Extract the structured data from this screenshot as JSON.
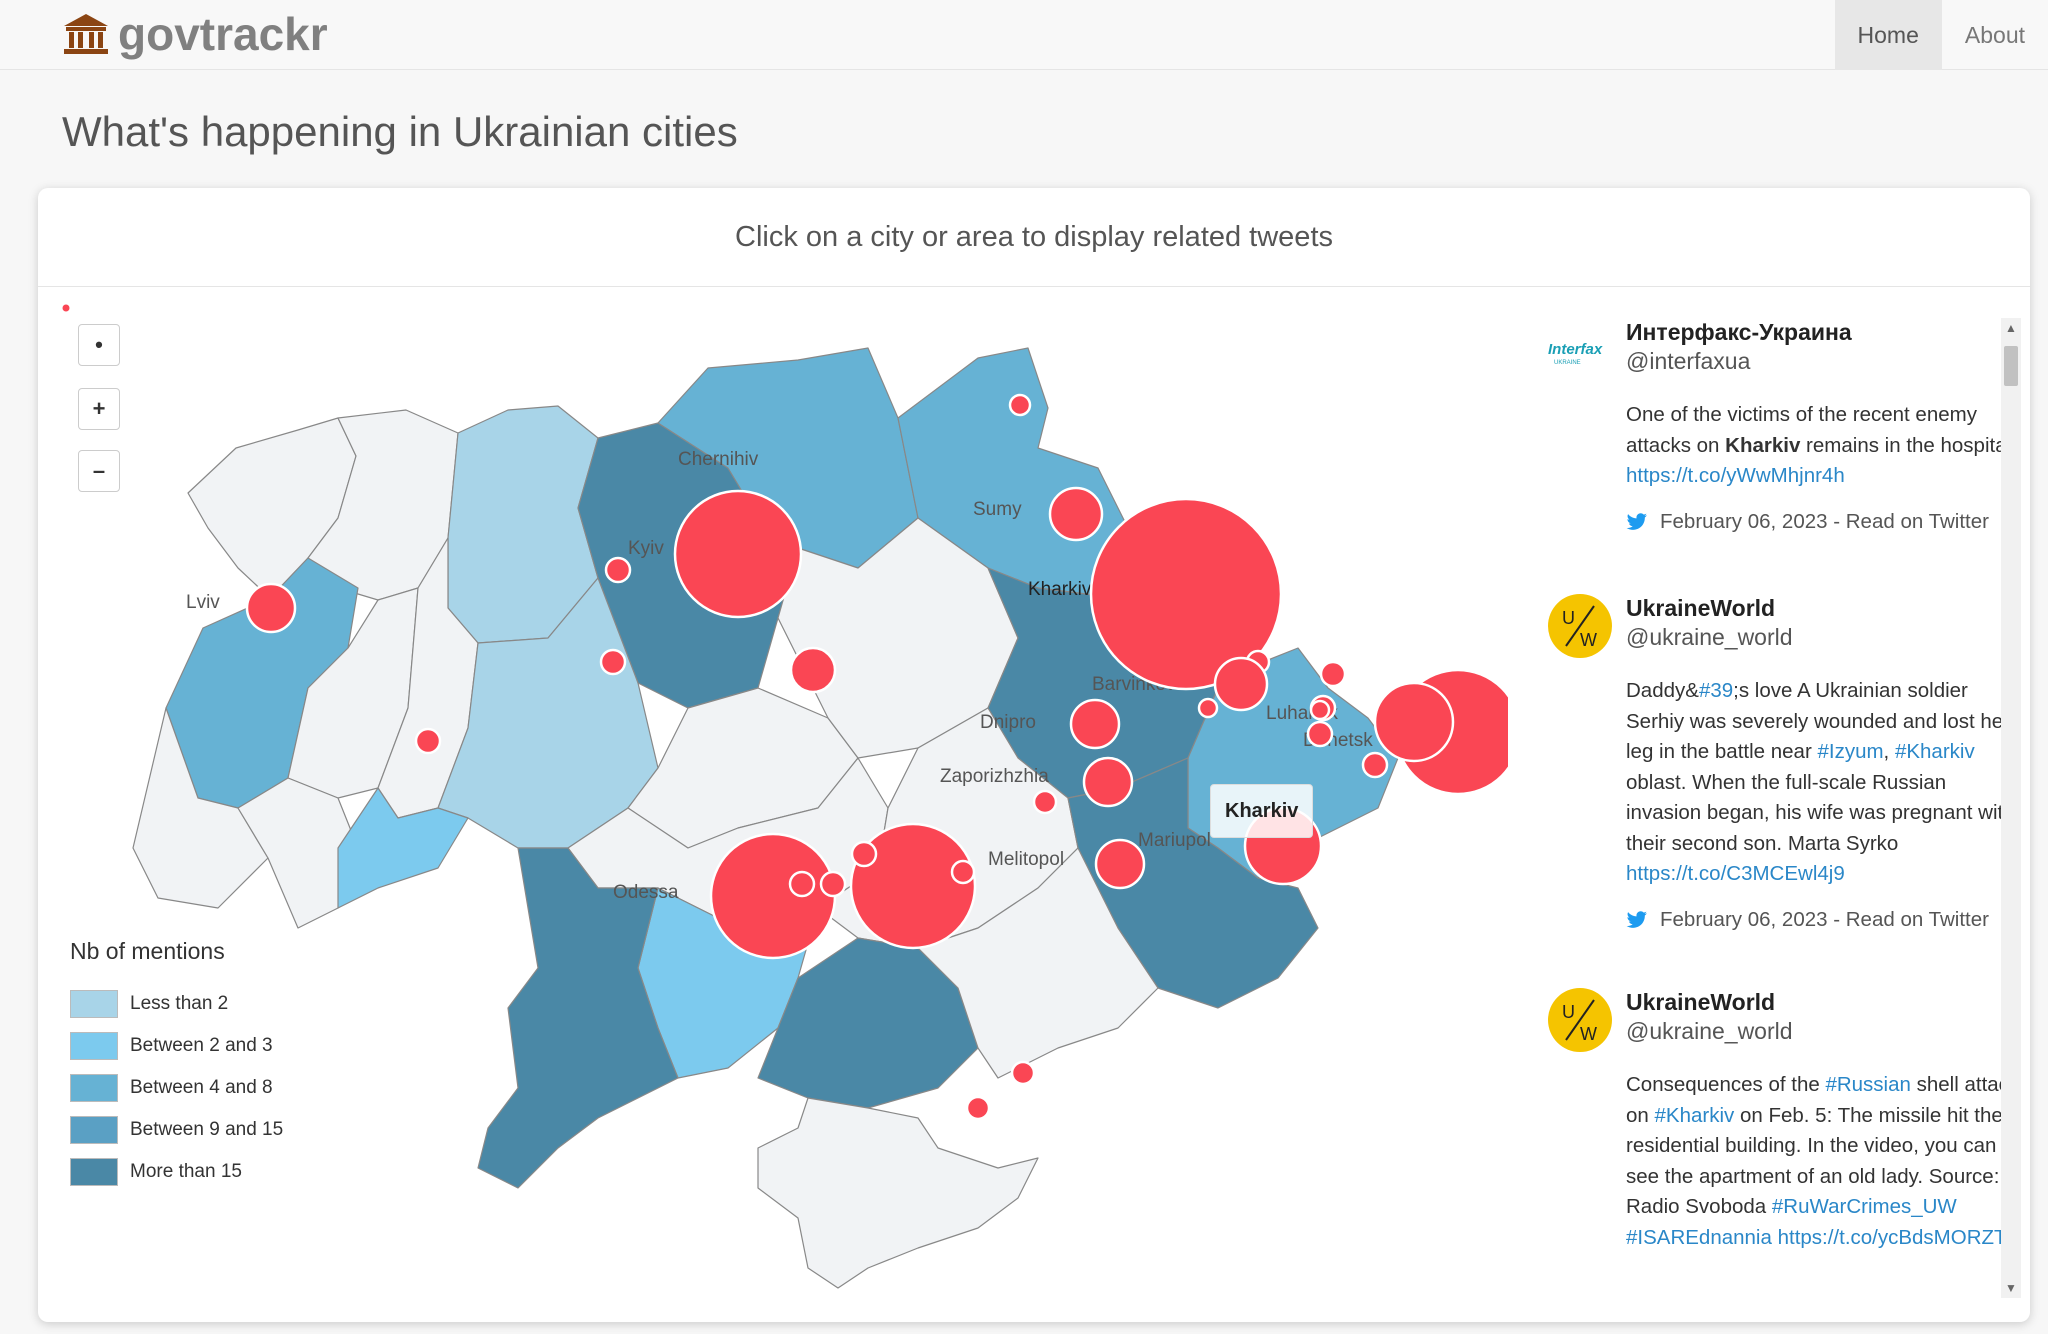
{
  "brand": {
    "name": "govtrackr"
  },
  "nav": {
    "items": [
      {
        "label": "Home"
      },
      {
        "label": "About"
      }
    ]
  },
  "page": {
    "title": "What's happening in Ukrainian cities"
  },
  "panel": {
    "header": "Click on a city or area to display related tweets"
  },
  "map": {
    "zoom": {
      "reset": "•",
      "in": "+",
      "out": "–"
    },
    "cities": [
      {
        "name": "Chernihiv"
      },
      {
        "name": "Kyiv"
      },
      {
        "name": "Sumy"
      },
      {
        "name": "Kharkiv"
      },
      {
        "name": "Lviv"
      },
      {
        "name": "Barvinkove"
      },
      {
        "name": "Dnipro"
      },
      {
        "name": "Luhansk"
      },
      {
        "name": "Donetsk"
      },
      {
        "name": "Zaporizhzhia"
      },
      {
        "name": "Mariupol"
      },
      {
        "name": "Melitopol"
      },
      {
        "name": "Odessa"
      }
    ],
    "tooltip": "Kharkiv",
    "colors": {
      "less2": "#a8d4e8",
      "b2_3": "#7ccaee",
      "b4_8": "#66b2d4",
      "b9_15": "#5aa0c4",
      "more15": "#4a88a6",
      "none": "#f1f3f5",
      "bubble": "#fa4654"
    }
  },
  "legend": {
    "title": "Nb of mentions",
    "items": [
      {
        "label": "Less than 2",
        "color": "#a8d4e8"
      },
      {
        "label": "Between 2 and 3",
        "color": "#7ccaee"
      },
      {
        "label": "Between 4 and 8",
        "color": "#66b2d4"
      },
      {
        "label": "Between 9 and 15",
        "color": "#5aa0c4"
      },
      {
        "label": "More than 15",
        "color": "#4a88a6"
      }
    ]
  },
  "tweets": [
    {
      "name": "Интерфакс-Украина",
      "handle": "@interfaxua",
      "avatar": "interfax-logo",
      "avatar_text": "Interfax",
      "avatar_sub": "UKRAINE",
      "text_a": "One of the victims of the recent enemy attacks on ",
      "text_kw": "Kharkiv",
      "text_b": " remains in the hospital ",
      "link": "https://t.co/yWwMhjnr4h",
      "meta": "February 06, 2023 - Read on Twitter"
    },
    {
      "name": "UkraineWorld",
      "handle": "@ukraine_world",
      "avatar": "ukraineworld-logo",
      "avatar_u": "U",
      "avatar_w": "W",
      "text_a": "Daddy&",
      "tag1": "#39",
      "text_b": ";s love A Ukrainian soldier Serhiy was severely wounded and lost her leg in the battle near ",
      "tag2": "#Izyum",
      "text_c": ", ",
      "tag3": "#Kharkiv",
      "text_d": " oblast. When the full-scale Russian invasion began, his wife was pregnant with their second son. Marta Syrko ",
      "link": "https://t.co/C3MCEwl4j9",
      "meta": "February 06, 2023 - Read on Twitter"
    },
    {
      "name": "UkraineWorld",
      "handle": "@ukraine_world",
      "avatar": "ukraineworld-logo",
      "avatar_u": "U",
      "avatar_w": "W",
      "text_a": "Consequences of the ",
      "tag1": "#Russian",
      "text_b": " shell attack on ",
      "tag2": "#Kharkiv",
      "text_c": " on Feb. 5: The missile hit the residential building. In the video, you can see the apartment of an old lady. Source: Radio Svoboda ",
      "tag3": "#RuWarCrimes_UW",
      "text_d": " ",
      "tag4": "#ISAREdnannia",
      "text_e": " ",
      "link": "https://t.co/ycBdsMORZT"
    }
  ]
}
